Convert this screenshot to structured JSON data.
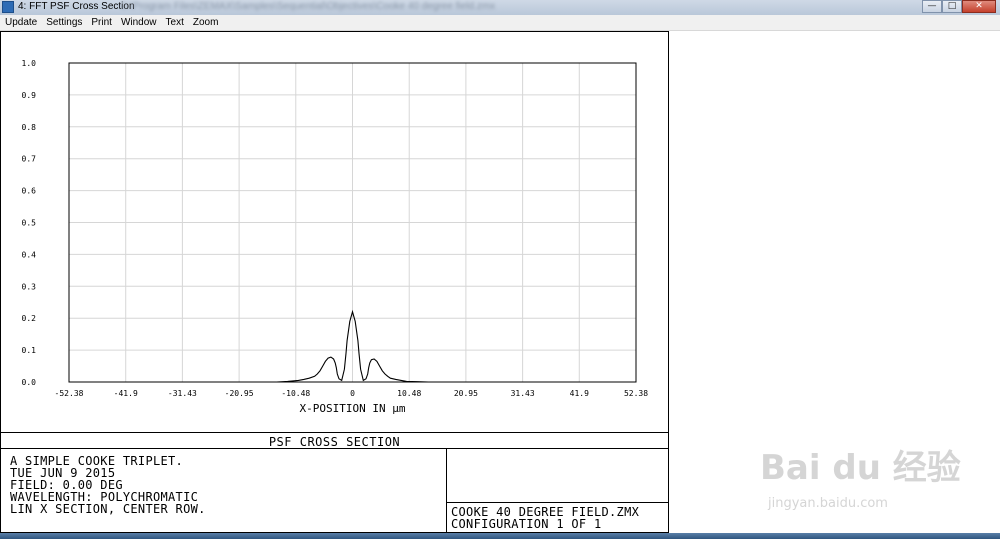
{
  "window": {
    "title": "4: FFT PSF Cross Section",
    "path_blurred": "C:\\Program Files\\ZEMAX\\Samples\\Sequential\\Objectives\\Cooke 40 degree field.zmx",
    "controls": {
      "minimize": "—",
      "maximize": "□",
      "close": "✕"
    }
  },
  "menu": {
    "items": [
      "Update",
      "Settings",
      "Print",
      "Window",
      "Text",
      "Zoom"
    ]
  },
  "chart_data": {
    "type": "line",
    "title": "PSF CROSS SECTION",
    "xlabel": "X-POSITION IN µm",
    "ylabel": "",
    "xlim": [
      -52.38,
      52.38
    ],
    "ylim": [
      0.0,
      1.0
    ],
    "x_ticks": [
      "-52.38",
      "-41.9",
      "-31.43",
      "-20.95",
      "-10.48",
      "0",
      "10.48",
      "20.95",
      "31.43",
      "41.9",
      "52.38"
    ],
    "x_tick_values": [
      -52.38,
      -41.9,
      -31.43,
      -20.95,
      -10.48,
      0,
      10.48,
      20.95,
      31.43,
      41.9,
      52.38
    ],
    "y_ticks": [
      "0.0",
      "0.1",
      "0.2",
      "0.3",
      "0.4",
      "0.5",
      "0.6",
      "0.7",
      "0.8",
      "0.9",
      "1.0"
    ],
    "grid": true,
    "series": [
      {
        "values_x": [
          -52.38,
          -14,
          -12,
          -10,
          -9,
          -8,
          -7,
          -6.5,
          -6,
          -5.5,
          -5,
          -4.5,
          -4,
          -3.5,
          -3.2,
          -3,
          -2.8,
          -2.5,
          -2,
          -1.5,
          -1.2,
          -1,
          -0.5,
          0,
          0.5,
          1,
          1.2,
          1.5,
          2,
          2.5,
          2.8,
          3,
          3.2,
          3.5,
          4,
          4.5,
          5,
          5.5,
          6,
          6.5,
          7,
          8,
          9,
          10,
          12,
          14,
          52.38
        ],
        "values_y": [
          0.0,
          0.0,
          0.002,
          0.005,
          0.008,
          0.012,
          0.018,
          0.025,
          0.035,
          0.05,
          0.065,
          0.075,
          0.078,
          0.072,
          0.06,
          0.045,
          0.025,
          0.01,
          0.005,
          0.04,
          0.09,
          0.13,
          0.19,
          0.22,
          0.19,
          0.13,
          0.09,
          0.04,
          0.005,
          0.01,
          0.025,
          0.045,
          0.06,
          0.07,
          0.072,
          0.065,
          0.05,
          0.035,
          0.025,
          0.018,
          0.012,
          0.008,
          0.005,
          0.002,
          0.001,
          0.0,
          0.0
        ]
      }
    ]
  },
  "info": {
    "lines": [
      "A SIMPLE COOKE TRIPLET.",
      "TUE JUN 9 2015",
      "FIELD: 0.00 DEG",
      "WAVELENGTH: POLYCHROMATIC",
      "LIN X SECTION, CENTER ROW."
    ],
    "file_name": "COOKE 40 DEGREE FIELD.ZMX",
    "configuration": "CONFIGURATION 1 OF 1"
  },
  "watermark": {
    "text": "Bai du 经验",
    "sub": "jingyan.baidu.com"
  }
}
